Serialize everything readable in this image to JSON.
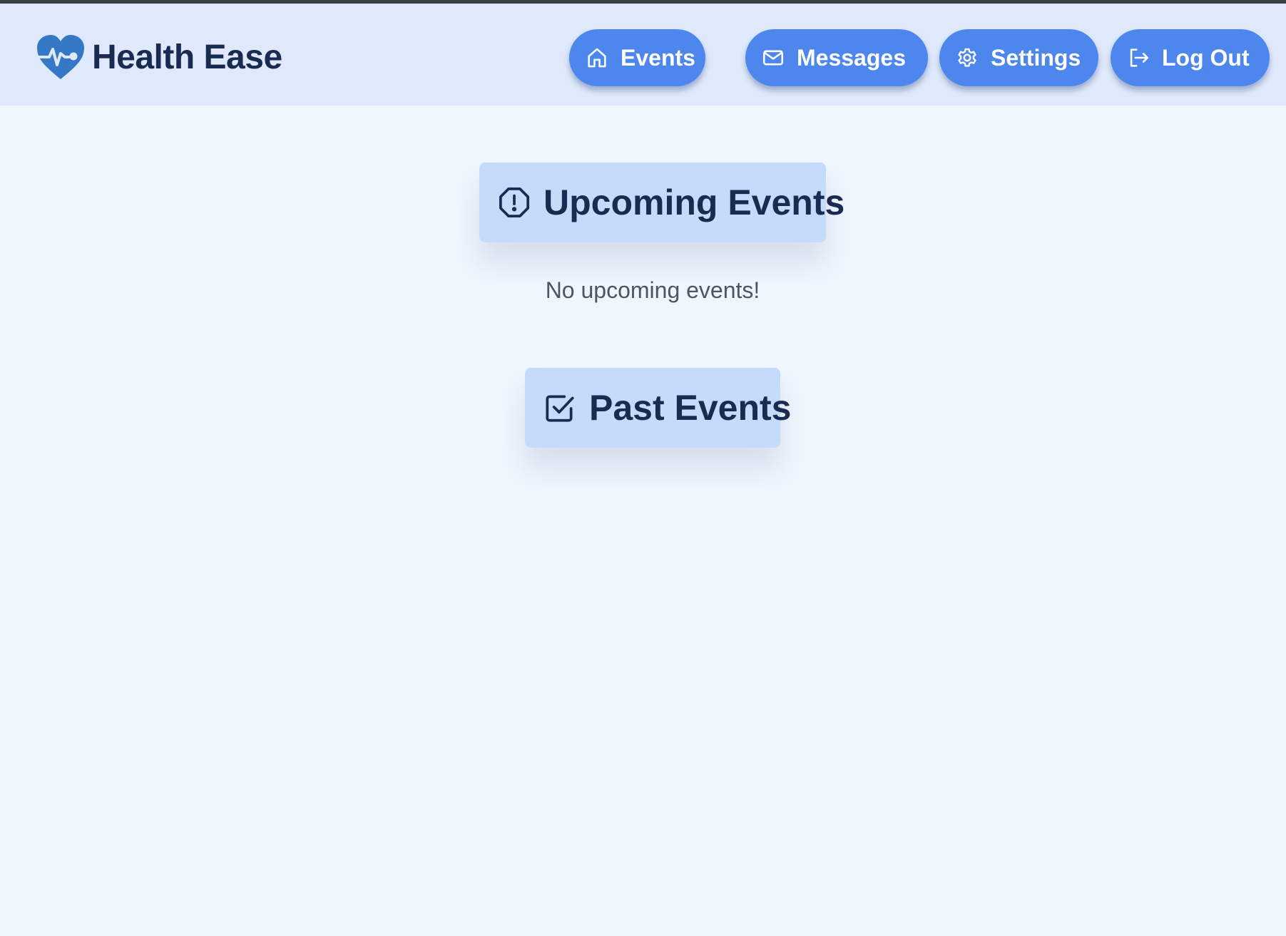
{
  "app": {
    "name": "Health Ease",
    "logo_icon": "heartbeat-icon"
  },
  "nav": {
    "events": {
      "label": "Events",
      "icon": "home-icon"
    },
    "messages": {
      "label": "Messages",
      "icon": "mail-icon"
    },
    "settings": {
      "label": "Settings",
      "icon": "gear-icon"
    },
    "logout": {
      "label": "Log Out",
      "icon": "logout-icon"
    }
  },
  "upcoming": {
    "title": "Upcoming Events",
    "icon": "alert-octagon-icon",
    "empty_message": "No upcoming events!"
  },
  "past": {
    "title": "Past Events",
    "icon": "check-square-icon"
  },
  "colors": {
    "header_bg": "#dfe9fb",
    "page_bg": "#f0f6fe",
    "button_bg": "#4d86ec",
    "section_bg": "#c5dbfa",
    "title_text": "#1a2b52",
    "logo": "#3578c6"
  }
}
